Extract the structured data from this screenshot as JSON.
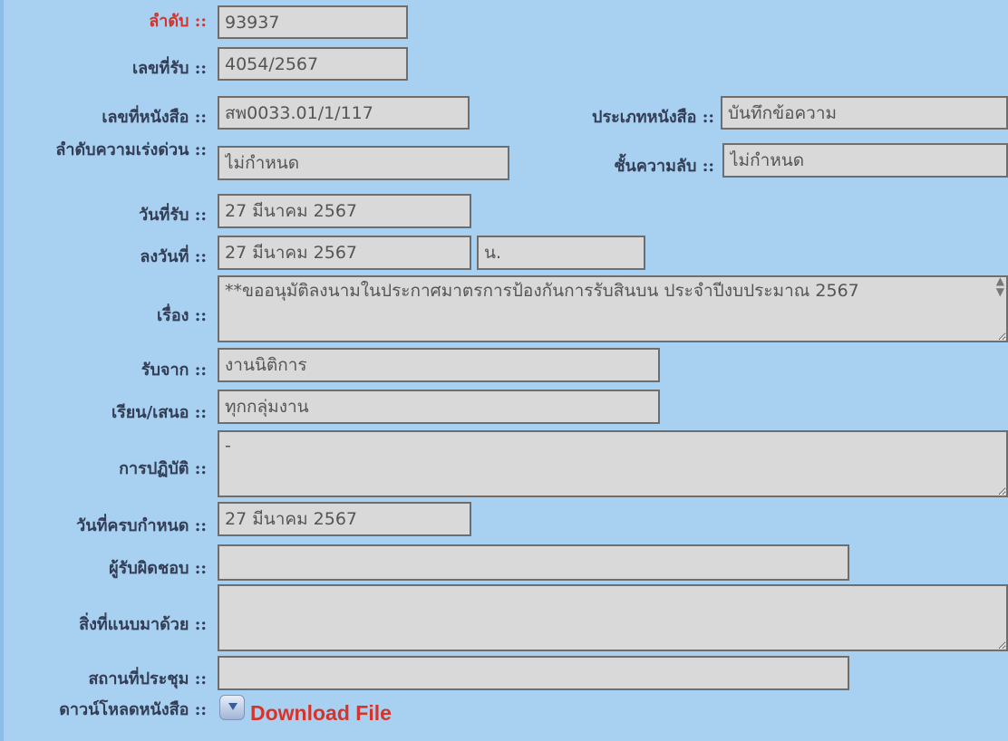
{
  "labels": {
    "seq": "ลำดับ ::",
    "receive_no": "เลขที่รับ ::",
    "doc_no": "เลขที่หนังสือ ::",
    "doc_type": "ประเภทหนังสือ ::",
    "urgency": "ลำดับความเร่งด่วน ::",
    "secrecy": "ชั้นความลับ ::",
    "receive_date": "วันที่รับ ::",
    "doc_date": "ลงวันที่ ::",
    "subject": "เรื่อง ::",
    "received_from": "รับจาก ::",
    "to": "เรียน/เสนอ ::",
    "action": "การปฏิบัติ ::",
    "due_date": "วันที่ครบกำหนด ::",
    "responsible": "ผู้รับผิดชอบ ::",
    "attachments": "สิ่งที่แนบมาด้วย ::",
    "meeting_place": "สถานที่ประชุม ::",
    "download": "ดาวน์โหลดหนังสือ ::"
  },
  "values": {
    "seq": "93937",
    "receive_no": "4054/2567",
    "doc_no": "สพ0033.01/1/117",
    "doc_type": "บันทึกข้อความ",
    "urgency": "ไม่กำหนด",
    "secrecy": "ไม่กำหนด",
    "receive_date": "27 มีนาคม 2567",
    "doc_date": "27 มีนาคม 2567",
    "doc_time": "น.",
    "subject": "**ขออนุมัติลงนามในประกาศมาตรการป้องกันการรับสินบน ประจำปีงบประมาณ 2567",
    "received_from": "งานนิติการ",
    "to": "ทุกกลุ่มงาน",
    "action": "-",
    "due_date": "27 มีนาคม 2567",
    "responsible": "",
    "attachments": "",
    "meeting_place": ""
  },
  "download_label": "Download File",
  "colors": {
    "background": "#a8d0f0",
    "label": "#333d55",
    "highlight": "#d6342b",
    "field": "#d9d9d9"
  }
}
